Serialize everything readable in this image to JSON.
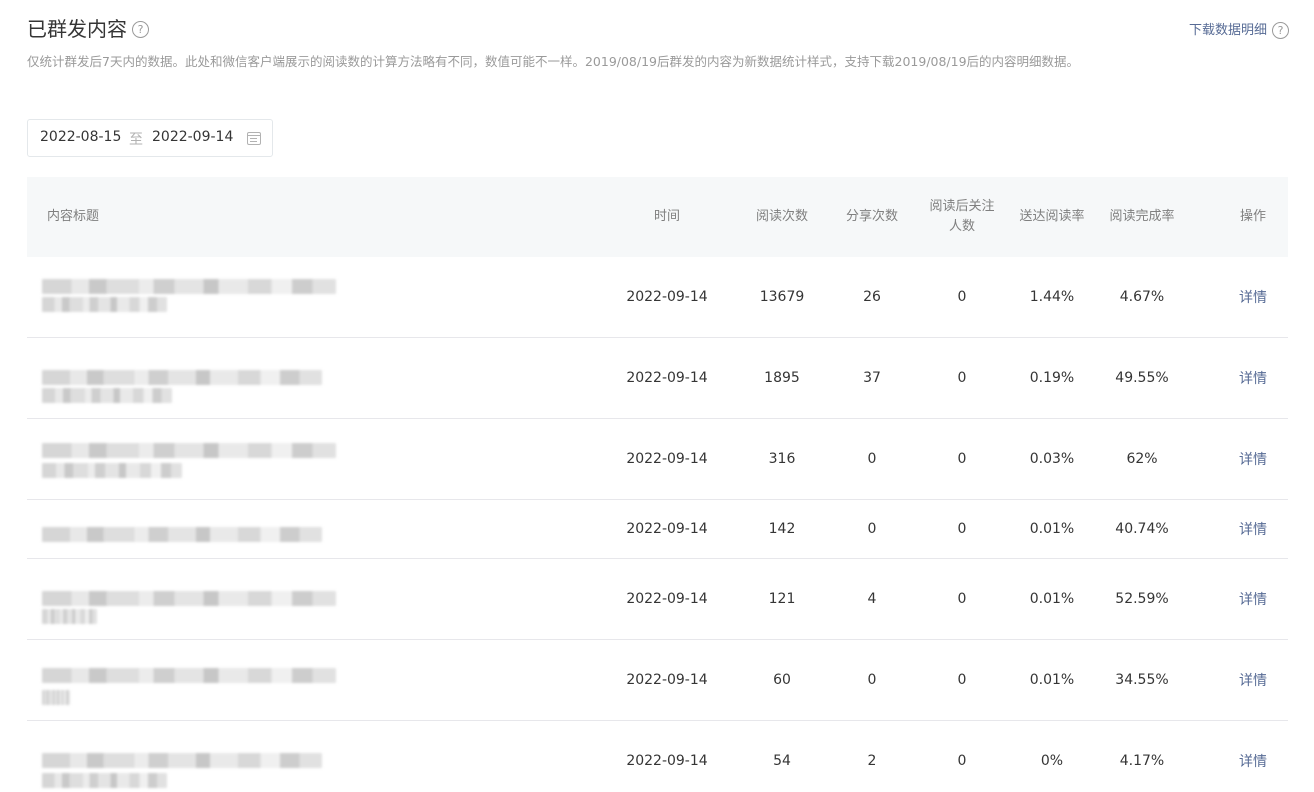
{
  "header": {
    "title": "已群发内容",
    "help_glyph": "?",
    "download_label": "下载数据明细",
    "download_help_glyph": "?"
  },
  "description": "仅统计群发后7天内的数据。此处和微信客户端展示的阅读数的计算方法略有不同，数值可能不一样。2019/08/19后群发的内容为新数据统计样式，支持下载2019/08/19后的内容明细数据。",
  "date_range": {
    "start": "2022-08-15",
    "separator": "至",
    "end": "2022-09-14",
    "icon": "calendar-icon"
  },
  "table": {
    "columns": {
      "title": "内容标题",
      "time": "时间",
      "reads": "阅读次数",
      "shares": "分享次数",
      "follows_line1": "阅读后关注",
      "follows_line2": "人数",
      "reach_rate": "送达阅读率",
      "completion_rate": "阅读完成率",
      "action": "操作"
    },
    "rows": [
      {
        "time": "2022-09-14",
        "reads": "13679",
        "shares": "26",
        "follows": "0",
        "reach_rate": "1.44%",
        "completion_rate": "4.67%",
        "action": "详情"
      },
      {
        "time": "2022-09-14",
        "reads": "1895",
        "shares": "37",
        "follows": "0",
        "reach_rate": "0.19%",
        "completion_rate": "49.55%",
        "action": "详情"
      },
      {
        "time": "2022-09-14",
        "reads": "316",
        "shares": "0",
        "follows": "0",
        "reach_rate": "0.03%",
        "completion_rate": "62%",
        "action": "详情"
      },
      {
        "time": "2022-09-14",
        "reads": "142",
        "shares": "0",
        "follows": "0",
        "reach_rate": "0.01%",
        "completion_rate": "40.74%",
        "action": "详情"
      },
      {
        "time": "2022-09-14",
        "reads": "121",
        "shares": "4",
        "follows": "0",
        "reach_rate": "0.01%",
        "completion_rate": "52.59%",
        "action": "详情"
      },
      {
        "time": "2022-09-14",
        "reads": "60",
        "shares": "0",
        "follows": "0",
        "reach_rate": "0.01%",
        "completion_rate": "34.55%",
        "action": "详情"
      },
      {
        "time": "2022-09-14",
        "reads": "54",
        "shares": "2",
        "follows": "0",
        "reach_rate": "0%",
        "completion_rate": "4.17%",
        "action": "详情"
      }
    ]
  },
  "colors": {
    "link": "#576b95",
    "header_bg": "#f6f8f9",
    "muted_text": "#9a9a9a"
  }
}
